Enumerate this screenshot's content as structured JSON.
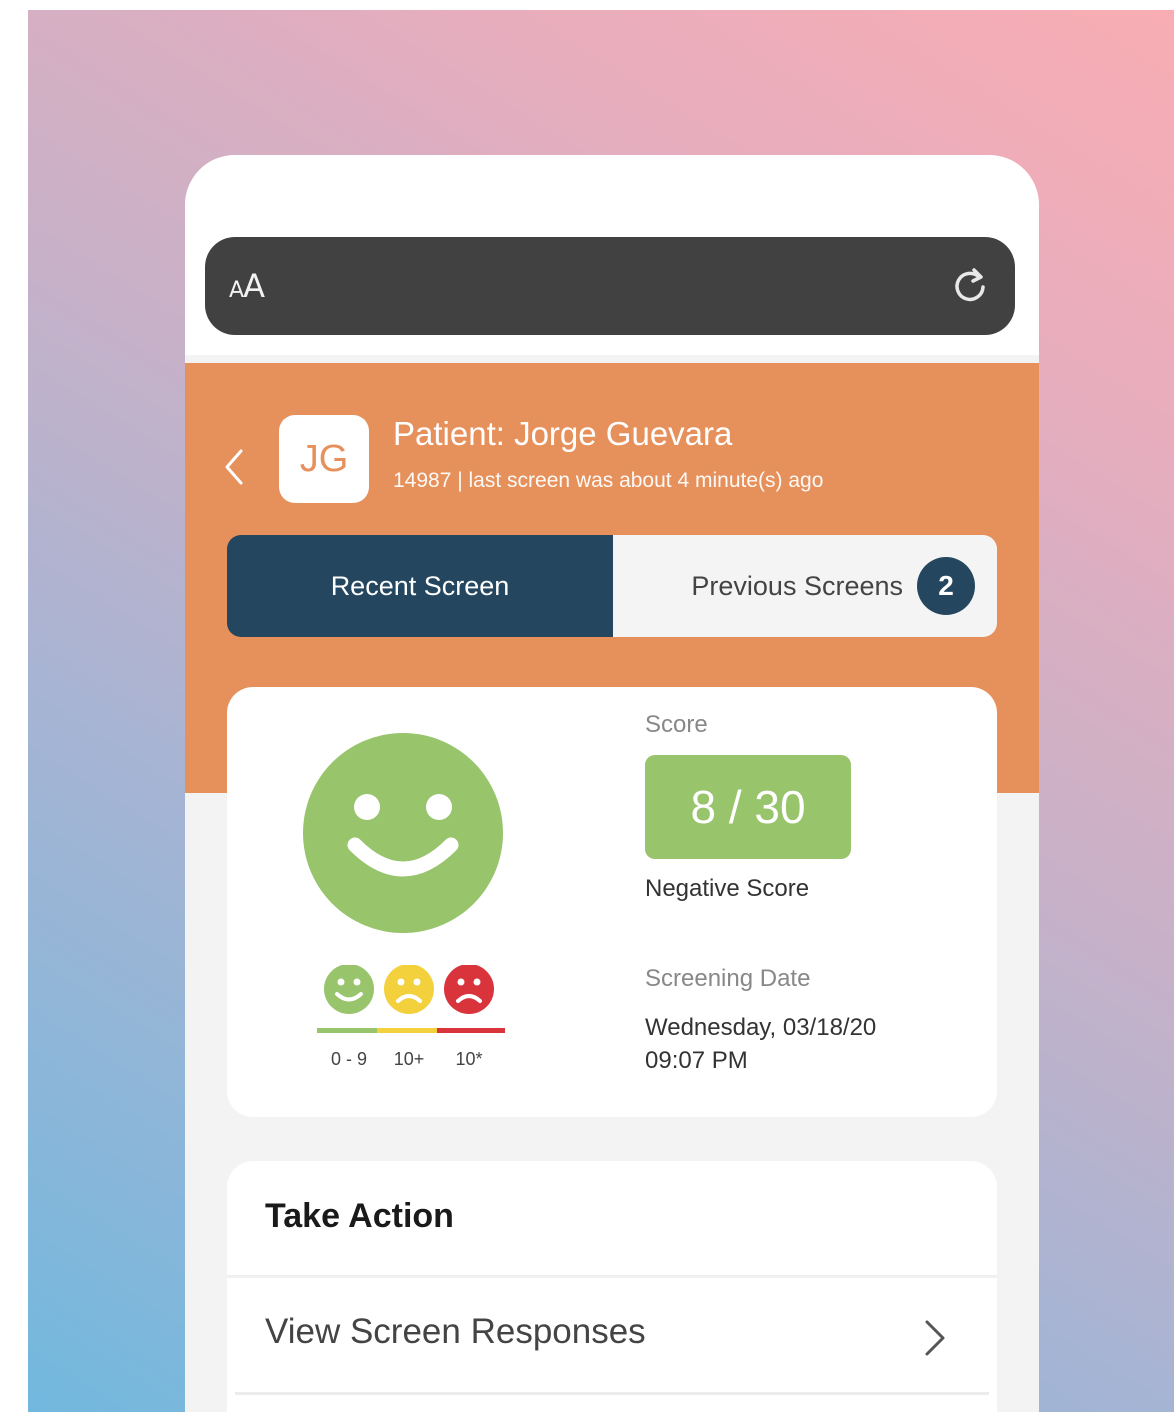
{
  "browser": {
    "text_size_label_small": "A",
    "text_size_label_large": "A",
    "reload_icon": "reload-icon"
  },
  "header": {
    "avatar_initials": "JG",
    "patient_name": "Patient: Jorge Guevara",
    "patient_meta": "14987 | last screen was about 4 minute(s) ago"
  },
  "tabs": [
    {
      "label": "Recent Screen",
      "active": true
    },
    {
      "label": "Previous Screens",
      "badge": "2",
      "active": false
    }
  ],
  "result": {
    "status_icon": "happy-face-icon",
    "scale": [
      {
        "icon": "happy-face-icon",
        "color": "#98c46c",
        "range": "0 - 9"
      },
      {
        "icon": "sad-face-icon",
        "color": "#f2d13c",
        "range": "10+"
      },
      {
        "icon": "upset-face-icon",
        "color": "#d9333b",
        "range": "10*"
      }
    ],
    "score_label": "Score",
    "score_value": "8 / 30",
    "score_text": "Negative Score",
    "date_label": "Screening Date",
    "date_line1": "Wednesday, 03/18/20",
    "date_line2": "09:07 PM"
  },
  "actions": {
    "title": "Take Action",
    "items": [
      {
        "label": "View Screen Responses"
      }
    ]
  },
  "colors": {
    "header_orange": "#e6915c",
    "navy": "#24475f",
    "green": "#98c46c"
  }
}
